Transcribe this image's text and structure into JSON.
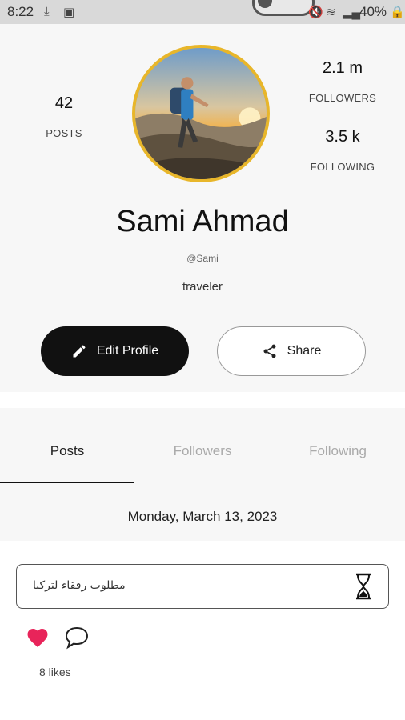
{
  "status_bar": {
    "time": "8:22",
    "battery": "40%"
  },
  "profile": {
    "posts": {
      "value": "42",
      "label": "POSTS"
    },
    "followers": {
      "value": "2.1 m",
      "label": "FOLLOWERS"
    },
    "following": {
      "value": "3.5 k",
      "label": "FOLLOWING"
    },
    "name": "Sami Ahmad",
    "handle": "@Sami",
    "bio": "traveler",
    "edit_label": "Edit Profile",
    "share_label": "Share"
  },
  "tabs": [
    {
      "label": "Posts",
      "active": true
    },
    {
      "label": "Followers",
      "active": false
    },
    {
      "label": "Following",
      "active": false
    }
  ],
  "feed": {
    "date": "Monday, March 13, 2023",
    "post_text": "مطلوب رفقاء لتركيا",
    "likes": "8 likes"
  },
  "colors": {
    "avatar_ring": "#e8b62a",
    "heart": "#e8245a",
    "primary_button": "#111111"
  }
}
